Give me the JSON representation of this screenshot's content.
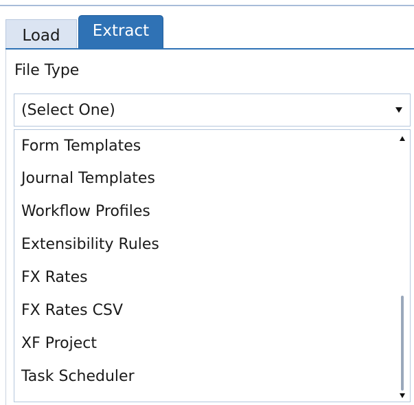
{
  "tabs": {
    "load_label": "Load",
    "extract_label": "Extract",
    "active": "Extract"
  },
  "file_type": {
    "label": "File Type",
    "selected": "(Select One)"
  },
  "dropdown": {
    "items": [
      "Form Templates",
      "Journal Templates",
      "Workflow Profiles",
      "Extensibility Rules",
      "FX Rates",
      "FX Rates CSV",
      "XF Project",
      "Task Scheduler"
    ],
    "scroll_position_fraction": 0.62
  },
  "colors": {
    "active_tab": "#2f72b5",
    "inactive_tab": "#dbe4f2",
    "border": "#b4c6dc"
  },
  "icons": {
    "select_arrow": "chevron-down-icon",
    "scroll_up": "scroll-up-arrow-icon",
    "scroll_down": "scroll-down-arrow-icon"
  }
}
